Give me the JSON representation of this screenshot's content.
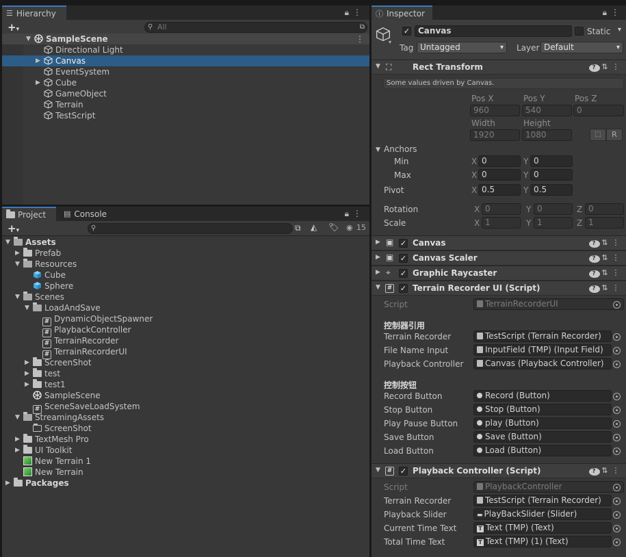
{
  "hierarchy": {
    "tab_label": "Hierarchy",
    "search_placeholder": "All",
    "scene": "SampleScene",
    "items": [
      {
        "label": "Directional Light"
      },
      {
        "label": "Canvas"
      },
      {
        "label": "EventSystem"
      },
      {
        "label": "Cube"
      },
      {
        "label": "GameObject"
      },
      {
        "label": "Terrain"
      },
      {
        "label": "TestScript"
      }
    ]
  },
  "project": {
    "tab_project": "Project",
    "tab_console": "Console",
    "badge_count": "15",
    "tree": {
      "assets": "Assets",
      "prefab": "Prefab",
      "resources": "Resources",
      "cube": "Cube",
      "sphere": "Sphere",
      "scenes": "Scenes",
      "loadandsave": "LoadAndSave",
      "dynamic": "DynamicObjectSpawner",
      "playback": "PlaybackController",
      "terrainrecorder": "TerrainRecorder",
      "terrainrecorderui": "TerrainRecorderUI",
      "screenshot": "ScreenShot",
      "test": "test",
      "test1": "test1",
      "samplescene": "SampleScene",
      "scenesaveload": "SceneSaveLoadSystem",
      "streaming": "StreamingAssets",
      "streaming_screenshot": "ScreenShot",
      "textmeshpro": "TextMesh Pro",
      "uitoolkit": "UI Toolkit",
      "newterrain1": "New Terrain 1",
      "newterrain": "New Terrain",
      "packages": "Packages"
    }
  },
  "inspector": {
    "tab_label": "Inspector",
    "object_name": "Canvas",
    "static_label": "Static",
    "tag_label": "Tag",
    "tag_value": "Untagged",
    "layer_label": "Layer",
    "layer_value": "Default",
    "rect": {
      "title": "Rect Transform",
      "note": "Some values driven by Canvas.",
      "posx_label": "Pos X",
      "posy_label": "Pos Y",
      "posz_label": "Pos Z",
      "posx": "960",
      "posy": "540",
      "posz": "0",
      "width_label": "Width",
      "height_label": "Height",
      "width": "1920",
      "height": "1080",
      "r_button": "R",
      "anchors": "Anchors",
      "min": "Min",
      "max": "Max",
      "x": "X",
      "y": "Y",
      "z": "Z",
      "min_x": "0",
      "min_y": "0",
      "max_x": "0",
      "max_y": "0",
      "pivot": "Pivot",
      "pivot_x": "0.5",
      "pivot_y": "0.5",
      "rotation": "Rotation",
      "rot_x": "0",
      "rot_y": "0",
      "rot_z": "0",
      "scale": "Scale",
      "scale_x": "1",
      "scale_y": "1",
      "scale_z": "1"
    },
    "components": {
      "canvas": "Canvas",
      "canvas_scaler": "Canvas Scaler",
      "graphic_raycaster": "Graphic Raycaster",
      "terrain_ui": "Terrain Recorder UI (Script)",
      "playback": "Playback Controller (Script)"
    },
    "terrain_ui": {
      "script_label": "Script",
      "script_value": "TerrainRecorderUI",
      "section1": "控制器引用",
      "terrain_recorder_label": "Terrain Recorder",
      "terrain_recorder_value": "TestScript (Terrain Recorder)",
      "file_name_label": "File Name Input",
      "file_name_value": "InputField (TMP) (Input Field)",
      "playback_label": "Playback Controller",
      "playback_value": "Canvas (Playback Controller)",
      "section2": "控制按钮",
      "record_label": "Record Button",
      "record_value": "Record (Button)",
      "stop_label": "Stop Button",
      "stop_value": "Stop (Button)",
      "play_label": "Play Pause Button",
      "play_value": "play (Button)",
      "save_label": "Save Button",
      "save_value": "Save (Button)",
      "load_label": "Load Button",
      "load_value": "Load (Button)"
    },
    "playback": {
      "script_label": "Script",
      "script_value": "PlaybackController",
      "terrain_label": "Terrain Recorder",
      "terrain_value": "TestScript (Terrain Recorder)",
      "slider_label": "Playback Slider",
      "slider_value": "PlayBackSlider (Slider)",
      "current_label": "Current Time Text",
      "current_value": "Text (TMP) (Text)",
      "total_label": "Total Time Text",
      "total_value": "Text (TMP) (1) (Text)"
    }
  }
}
